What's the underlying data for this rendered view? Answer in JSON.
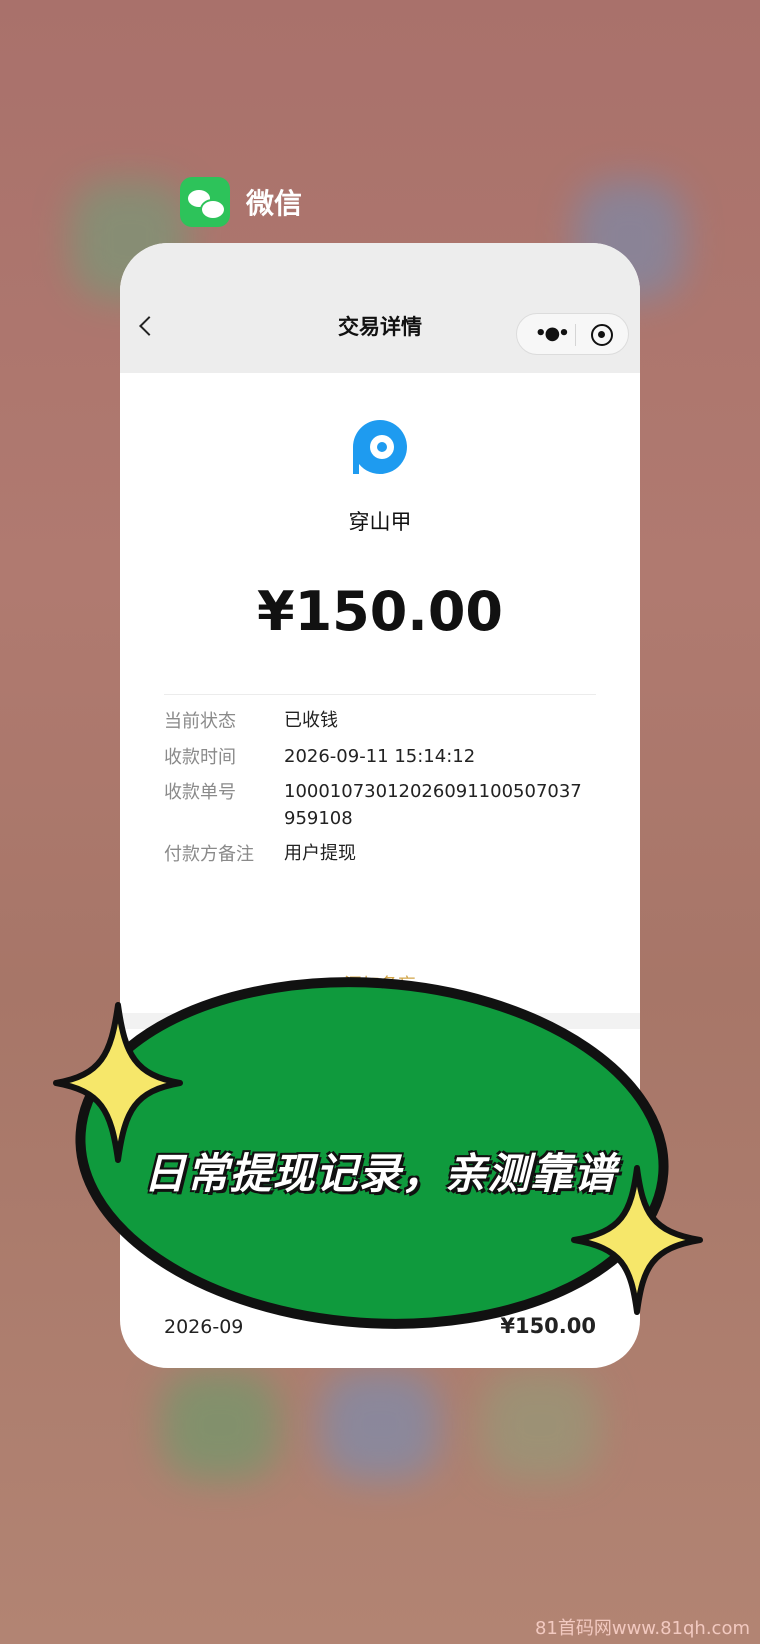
{
  "app": {
    "name": "微信"
  },
  "nav": {
    "title": "交易详情"
  },
  "merchant": {
    "name": "穿山甲"
  },
  "amount": "¥150.00",
  "details": [
    {
      "label": "当前状态",
      "value": "已收钱"
    },
    {
      "label": "收款时间",
      "value": "2026-09-11 15:14:12"
    },
    {
      "label": "收款单号",
      "value": "10001073012026091100507037959108"
    },
    {
      "label": "付款方备注",
      "value": "用户提现"
    }
  ],
  "add_memo": "添加备忘",
  "bottom_row": {
    "date": "2026-09",
    "amount": "¥150.00"
  },
  "banner": {
    "text": "日常提现记录，亲测靠谱"
  },
  "watermark": "81首码网www.81qh.com",
  "colors": {
    "wechat_green": "#2dc35a",
    "banner_green": "#0f9a3d",
    "memo_gold": "#d2a64a",
    "sparkle": "#f6e76a"
  }
}
